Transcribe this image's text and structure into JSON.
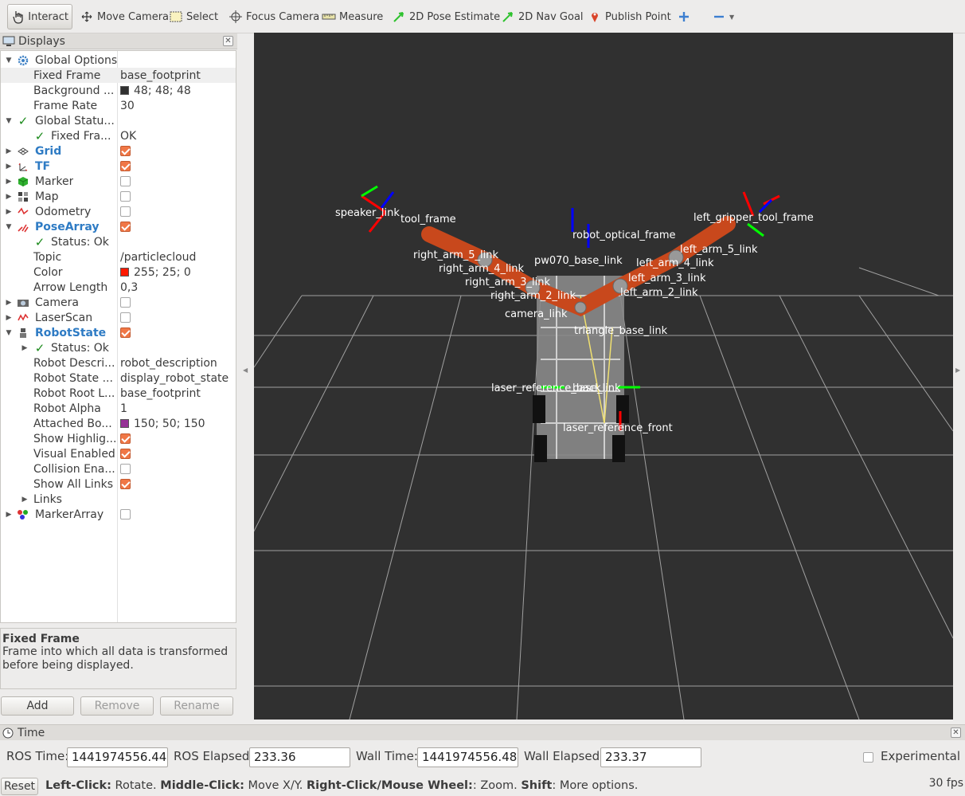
{
  "toolbar": {
    "interact": "Interact",
    "move_camera": "Move Camera",
    "select": "Select",
    "focus_camera": "Focus Camera",
    "measure": "Measure",
    "pose_estimate": "2D Pose Estimate",
    "nav_goal": "2D Nav Goal",
    "publish_point": "Publish Point",
    "add_icon": "plus-icon",
    "remove_icon": "minus-icon"
  },
  "displays": {
    "title": "Displays",
    "rows": [
      {
        "label": "Global Options",
        "value": ""
      },
      {
        "label": "Fixed Frame",
        "value": "base_footprint"
      },
      {
        "label": "Background ...",
        "value": "48; 48; 48",
        "color": "#303030"
      },
      {
        "label": "Frame Rate",
        "value": "30"
      },
      {
        "label": "Global Statu...",
        "value": ""
      },
      {
        "label": "Fixed Fra...",
        "value": "OK"
      },
      {
        "label": "Grid",
        "checked": true
      },
      {
        "label": "TF",
        "checked": true
      },
      {
        "label": "Marker",
        "checked": false
      },
      {
        "label": "Map",
        "checked": false
      },
      {
        "label": "Odometry",
        "checked": false
      },
      {
        "label": "PoseArray",
        "checked": true
      },
      {
        "label": "Status: Ok",
        "value": ""
      },
      {
        "label": "Topic",
        "value": "/particlecloud"
      },
      {
        "label": "Color",
        "value": "255; 25; 0",
        "color": "#ff1900"
      },
      {
        "label": "Arrow Length",
        "value": "0,3"
      },
      {
        "label": "Camera",
        "checked": false
      },
      {
        "label": "LaserScan",
        "checked": false
      },
      {
        "label": "RobotState",
        "checked": true
      },
      {
        "label": "Status: Ok",
        "value": ""
      },
      {
        "label": "Robot Descri...",
        "value": "robot_description"
      },
      {
        "label": "Robot State ...",
        "value": "display_robot_state"
      },
      {
        "label": "Robot Root L...",
        "value": "base_footprint"
      },
      {
        "label": "Robot Alpha",
        "value": "1"
      },
      {
        "label": "Attached Bo...",
        "value": "150; 50; 150",
        "color": "#963296"
      },
      {
        "label": "Show Highlig...",
        "checked": true
      },
      {
        "label": "Visual Enabled",
        "checked": true
      },
      {
        "label": "Collision Ena...",
        "checked": false
      },
      {
        "label": "Show All Links",
        "checked": true
      },
      {
        "label": "Links",
        "value": ""
      },
      {
        "label": "MarkerArray",
        "checked": false
      }
    ],
    "help_title": "Fixed Frame",
    "help_desc": "Frame into which all data is transformed before being displayed.",
    "add": "Add",
    "remove": "Remove",
    "rename": "Rename"
  },
  "scene": {
    "labels": [
      "left_gripper_tool_frame",
      "left_arm_5_link",
      "left_arm_4_link",
      "left_arm_3_link",
      "left_arm_2_link",
      "right_arm_5_link",
      "right_arm_4_link",
      "right_arm_3_link",
      "right_arm_2_link",
      "pw070_base_link",
      "triangle_base_link",
      "laser_reference_back",
      "base_link",
      "laser_reference_front",
      "speaker_link",
      "camera_link",
      "tool_frame",
      "robot_optical_frame"
    ]
  },
  "time": {
    "title": "Time",
    "ros_time_label": "ROS Time:",
    "ros_time": "1441974556.44",
    "ros_elapsed_label": "ROS Elapsed:",
    "ros_elapsed": "233.36",
    "wall_time_label": "Wall Time:",
    "wall_time": "1441974556.48",
    "wall_elapsed_label": "Wall Elapsed:",
    "wall_elapsed": "233.37",
    "experimental": "Experimental"
  },
  "status": {
    "reset": "Reset",
    "h1": "Left-Click:",
    "t1": " Rotate. ",
    "h2": "Middle-Click:",
    "t2": " Move X/Y. ",
    "h3": "Right-Click/Mouse Wheel:",
    "t3": ": Zoom. ",
    "h4": "Shift",
    "t4": ": More options.",
    "fps": "30 fps"
  }
}
